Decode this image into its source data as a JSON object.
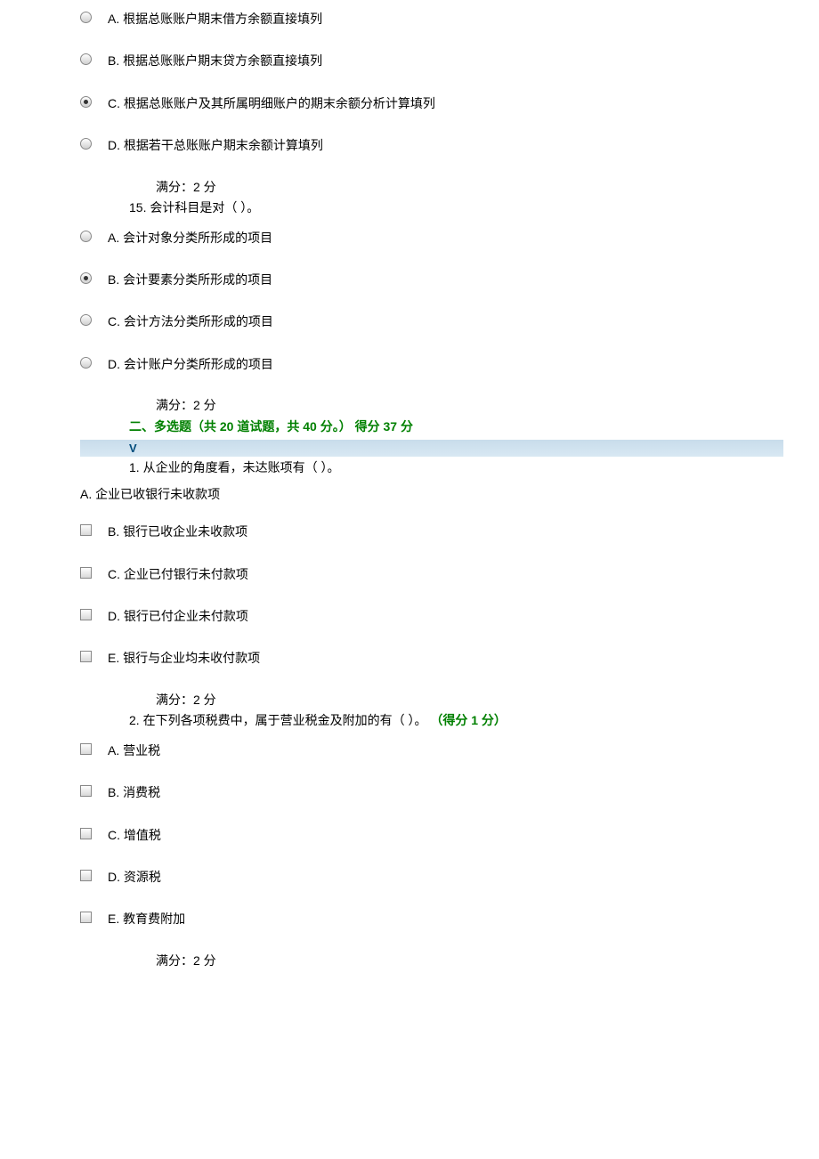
{
  "q14": {
    "options": {
      "A": "A. 根据总账账户期末借方余额直接填列",
      "B": "B. 根据总账账户期末贷方余额直接填列",
      "C": "C. 根据总账账户及其所属明细账户的期末余额分析计算填列",
      "D": "D. 根据若干总账账户期末余额计算填列"
    },
    "score": "满分：2 分"
  },
  "q15": {
    "number": "15.  会计科目是对（ ）。",
    "options": {
      "A": "A. 会计对象分类所形成的项目",
      "B": "B. 会计要素分类所形成的项目",
      "C": "C. 会计方法分类所形成的项目",
      "D": "D. 会计账户分类所形成的项目"
    },
    "score": "满分：2 分"
  },
  "section2": {
    "title": "二、多选题（共 20 道试题，共 40 分。）   得分 37 分",
    "v": "V"
  },
  "mq1": {
    "number": "1.  从企业的角度看，未达账项有（  ）。",
    "optA": "A. 企业已收银行未收款项",
    "options": {
      "B": "B. 银行已收企业未收款项",
      "C": "C. 企业已付银行未付款项",
      "D": "D. 银行已付企业未付款项",
      "E": "E. 银行与企业均未收付款项"
    },
    "score": "满分：2 分"
  },
  "mq2": {
    "number_prefix": "2.  在下列各项税费中，属于营业税金及附加的有（  ）。  ",
    "got": "（得分 1 分）",
    "options": {
      "A": "A. 营业税",
      "B": "B. 消费税",
      "C": "C. 增值税",
      "D": "D. 资源税",
      "E": "E. 教育费附加"
    },
    "score": "满分：2 分"
  }
}
